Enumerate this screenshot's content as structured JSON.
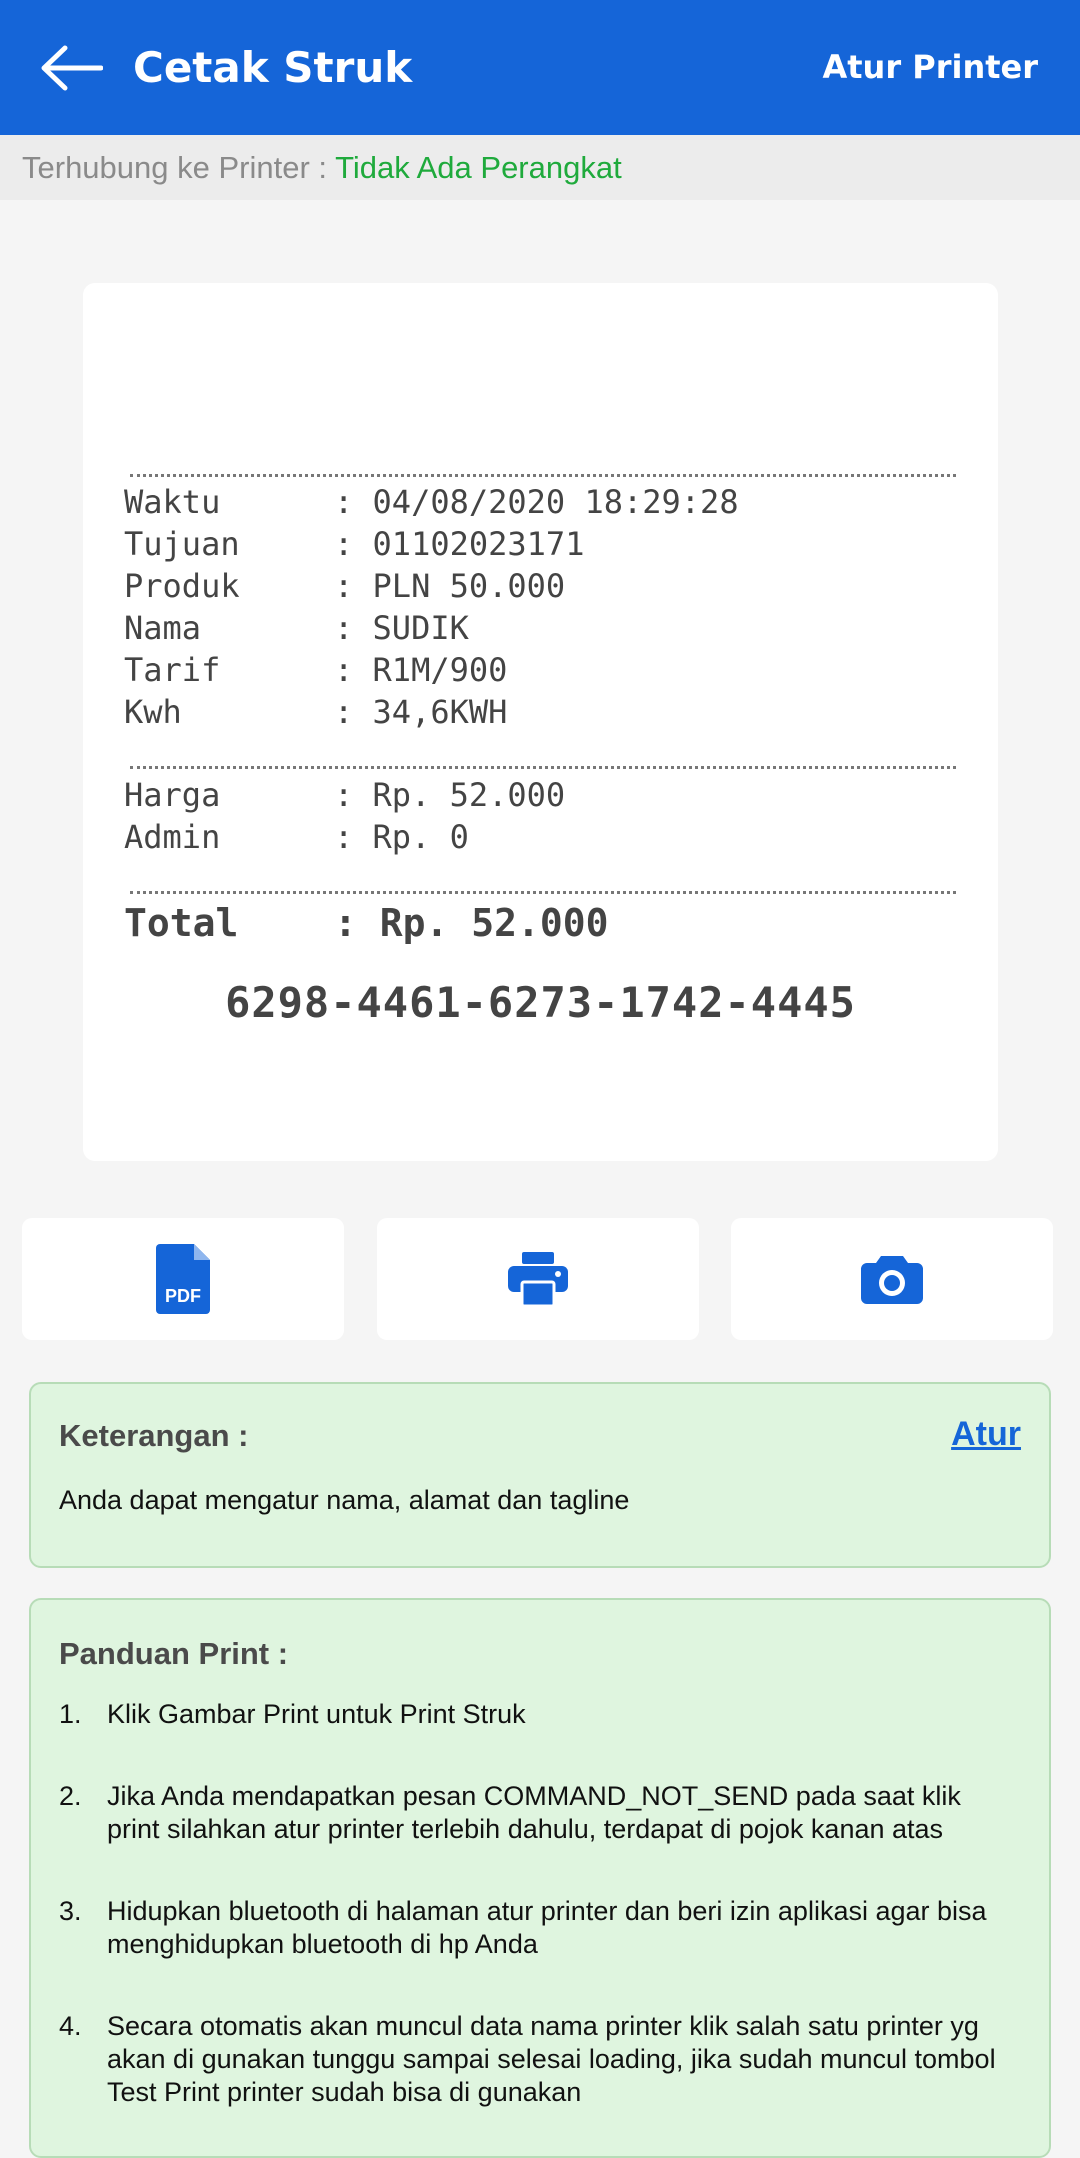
{
  "appbar": {
    "title": "Cetak Struk",
    "action": "Atur Printer"
  },
  "printer_status": {
    "label": "Terhubung ke Printer : ",
    "value": "Tidak Ada Perangkat"
  },
  "receipt": {
    "rows": [
      {
        "key": "Waktu",
        "value": ": 04/08/2020 18:29:28"
      },
      {
        "key": "Tujuan",
        "value": ": 01102023171"
      },
      {
        "key": "Produk",
        "value": ": PLN 50.000"
      },
      {
        "key": "Nama",
        "value": ": SUDIK"
      },
      {
        "key": "Tarif",
        "value": ": R1M/900"
      },
      {
        "key": "Kwh",
        "value": ": 34,6KWH"
      }
    ],
    "price_rows": [
      {
        "key": "Harga",
        "value": ": Rp. 52.000"
      },
      {
        "key": "Admin",
        "value": ": Rp. 0"
      }
    ],
    "total": {
      "key": "Total",
      "value": ": Rp. 52.000"
    },
    "token": "6298-4461-6273-1742-4445"
  },
  "actions": {
    "pdf_icon": "pdf-file-icon",
    "pdf_label": "PDF",
    "print_icon": "printer-icon",
    "camera_icon": "camera-icon"
  },
  "keterangan": {
    "title": "Keterangan :",
    "link": "Atur",
    "text": "Anda dapat mengatur nama, alamat dan tagline"
  },
  "panduan": {
    "title": "Panduan Print :",
    "items": [
      {
        "num": "1.",
        "text": "Klik Gambar Print untuk Print Struk"
      },
      {
        "num": "2.",
        "text": "Jika Anda mendapatkan pesan COMMAND_NOT_SEND pada saat klik print silahkan atur printer terlebih dahulu, terdapat di pojok kanan atas"
      },
      {
        "num": "3.",
        "text": "Hidupkan bluetooth di halaman atur printer dan beri izin aplikasi agar bisa menghidupkan bluetooth di hp Anda"
      },
      {
        "num": "4.",
        "text": "Secara otomatis akan muncul data nama printer klik salah satu printer yg akan di gunakan tunggu sampai selesai loading, jika sudah muncul tombol Test Print printer sudah bisa di gunakan"
      }
    ]
  },
  "colors": {
    "primary": "#1565d8",
    "status_ok": "#1faa3c",
    "info_bg": "#dff5df"
  }
}
